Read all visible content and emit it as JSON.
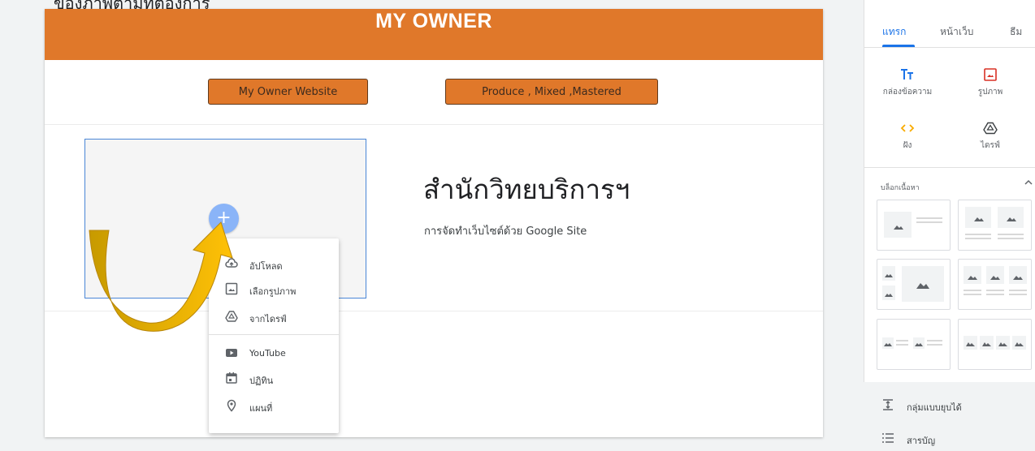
{
  "top_cut_text": "ของภาพตามที่ต้องการ",
  "site": {
    "title": "MY OWNER",
    "nav_buttons": [
      "My Owner Website",
      "Produce , Mixed ,Mastered"
    ],
    "heading": "สำนักวิทยบริการฯ",
    "subtext": "การจัดทำเว็บไซต์ด้วย Google Site"
  },
  "insert_menu": {
    "items": [
      {
        "label": "อัปโหลด",
        "icon": "cloud-upload-icon"
      },
      {
        "label": "เลือกรูปภาพ",
        "icon": "image-icon"
      },
      {
        "label": "จากไดรฟ์",
        "icon": "drive-icon"
      },
      {
        "label": "YouTube",
        "icon": "youtube-icon"
      },
      {
        "label": "ปฏิทิน",
        "icon": "calendar-icon"
      },
      {
        "label": "แผนที่",
        "icon": "map-pin-icon"
      }
    ]
  },
  "panel": {
    "tabs": [
      "แทรก",
      "หน้าเว็บ",
      "ธีม"
    ],
    "active_tab": "แทรก",
    "tools": [
      {
        "label": "กล่องข้อความ",
        "icon": "text-box-icon"
      },
      {
        "label": "รูปภาพ",
        "icon": "image-icon"
      },
      {
        "label": "ฝัง",
        "icon": "embed-icon"
      },
      {
        "label": "ไดรฟ์",
        "icon": "drive-icon"
      }
    ],
    "section_title": "บล็อกเนื้อหา",
    "bottom_items": [
      {
        "label": "กลุ่มแบบยุบได้",
        "icon": "collapsible-icon"
      },
      {
        "label": "สารบัญ",
        "icon": "list-icon"
      }
    ]
  },
  "colors": {
    "header": "#e0782a",
    "accent_blue": "#1a73e8",
    "add_button": "#8ab4f8",
    "arrow": "#f2b800"
  }
}
